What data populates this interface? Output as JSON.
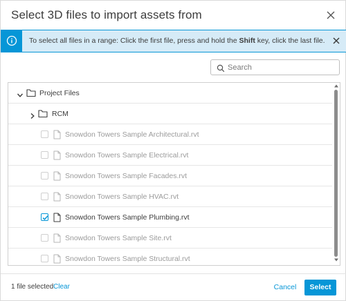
{
  "dialog": {
    "title": "Select 3D files to import assets from"
  },
  "info_banner": {
    "text_before": "To select all files in a range: Click the first file, press and hold the ",
    "text_bold": "Shift",
    "text_after": " key, click the last file."
  },
  "search": {
    "placeholder": "Search",
    "value": ""
  },
  "tree": {
    "root": {
      "label": "Project Files",
      "expanded": true
    },
    "folder": {
      "label": "RCM",
      "expanded": false
    },
    "files": [
      {
        "label": "Snowdon Towers Sample Architectural.rvt",
        "checked": false,
        "enabled": false
      },
      {
        "label": "Snowdon Towers Sample Electrical.rvt",
        "checked": false,
        "enabled": false
      },
      {
        "label": "Snowdon Towers Sample Facades.rvt",
        "checked": false,
        "enabled": false
      },
      {
        "label": "Snowdon Towers Sample HVAC.rvt",
        "checked": false,
        "enabled": false
      },
      {
        "label": "Snowdon Towers Sample Plumbing.rvt",
        "checked": true,
        "enabled": true
      },
      {
        "label": "Snowdon Towers Sample Site.rvt",
        "checked": false,
        "enabled": false
      },
      {
        "label": "Snowdon Towers Sample Structural.rvt",
        "checked": false,
        "enabled": false
      }
    ]
  },
  "footer": {
    "selected_text": "1 file selected",
    "clear_label": "Clear",
    "cancel_label": "Cancel",
    "select_label": "Select"
  },
  "colors": {
    "accent": "#0696d7",
    "banner_bg": "#d6ebf7",
    "disabled_text": "#9b9b9b"
  },
  "icons": {
    "close": "close-icon",
    "info": "info-icon",
    "search": "search-icon",
    "folder": "folder-icon",
    "file": "file-icon",
    "chevron_down": "chevron-down-icon",
    "chevron_right": "chevron-right-icon",
    "checkmark": "checkmark-icon"
  }
}
